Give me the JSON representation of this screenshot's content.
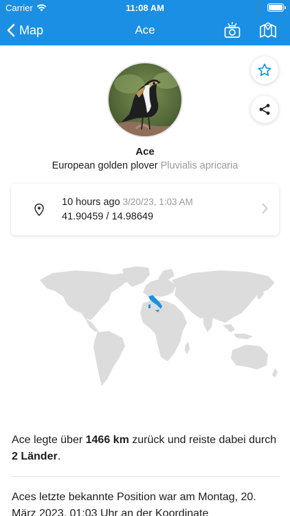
{
  "status_bar": {
    "carrier": "Carrier",
    "time": "11:08 AM",
    "battery_level": 1.0
  },
  "nav": {
    "back_label": "Map",
    "title": "Ace",
    "icons": [
      "camera-icon",
      "map-icon"
    ]
  },
  "bird": {
    "name": "Ace",
    "common_name": "European golden plover",
    "latin_name": "Pluvialis apricaria"
  },
  "actions": {
    "icons": [
      "star-icon",
      "share-icon"
    ]
  },
  "location": {
    "relative_time": "10 hours ago",
    "timestamp": "3/20/23, 1:03 AM",
    "coordinates": "41.90459 / 14.98649"
  },
  "map": {
    "highlighted_country": "Italy"
  },
  "summary": {
    "part1": "Ace legte über ",
    "distance": "1466 km",
    "part2": " zurück und reiste dabei durch ",
    "countries": "2 Länder",
    "part3": "."
  },
  "last_position": {
    "text": "Aces letzte bekannte Position war am Montag, 20. März 2023, 01:03 Uhr an der Koordinate"
  },
  "colors": {
    "accent": "#1a8fe3",
    "land": "#dcdcdc",
    "highlight": "#1a8fe3",
    "secondary_text": "#9a9a9a"
  }
}
